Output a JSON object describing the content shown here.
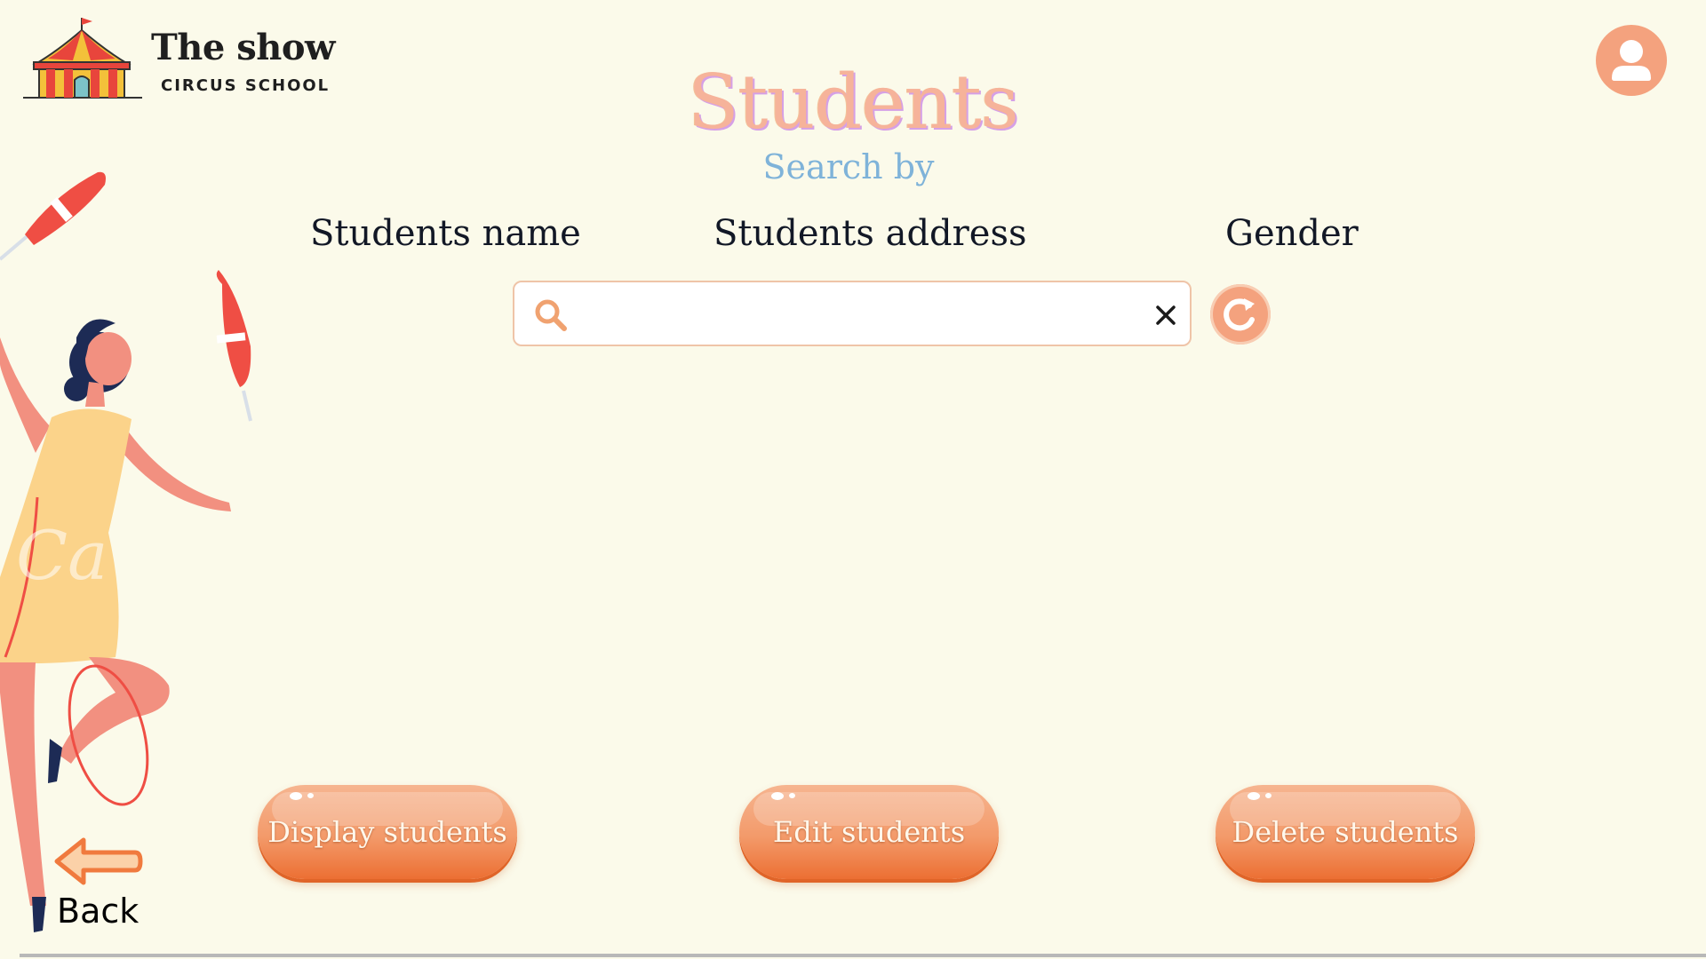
{
  "header": {
    "logo_title": "The show",
    "logo_subtitle": "CIRCUS SCHOOL",
    "avatar_icon": "user-icon"
  },
  "main": {
    "title": "Students",
    "search_by": "Search by",
    "filters": {
      "name": "Students name",
      "address": "Students address",
      "gender": "Gender"
    },
    "search": {
      "value": "",
      "placeholder": ""
    }
  },
  "actions": {
    "display": "Display students",
    "edit": "Edit students",
    "delete": "Delete students"
  },
  "nav": {
    "back": "Back"
  },
  "colors": {
    "background": "#fbfaea",
    "accent": "#f4a27e",
    "button_orange": "#ec6f33",
    "title_peach": "#f6b39a",
    "search_by_blue": "#7fb3d9"
  }
}
